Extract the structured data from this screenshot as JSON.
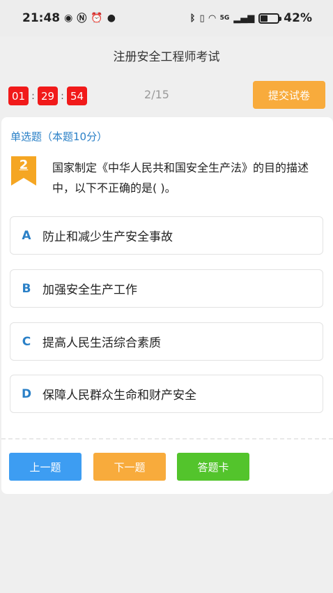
{
  "status": {
    "time": "21:48",
    "battery": "42%",
    "battery_level": 0.42,
    "network": "5G"
  },
  "header": {
    "title": "注册安全工程师考试"
  },
  "timer": {
    "hours": "01",
    "minutes": "29",
    "seconds": "54",
    "separator": ":"
  },
  "progress": "2/15",
  "submit_label": "提交试卷",
  "question": {
    "type_label": "单选题（本题10分）",
    "number": "2",
    "text": "国家制定《中华人民共和国安全生产法》的目的描述中，以下不正确的是( )。",
    "options": [
      {
        "letter": "A",
        "text": "防止和减少生产安全事故"
      },
      {
        "letter": "B",
        "text": "加强安全生产工作"
      },
      {
        "letter": "C",
        "text": "提高人民生活综合素质"
      },
      {
        "letter": "D",
        "text": "保障人民群众生命和财产安全"
      }
    ]
  },
  "nav": {
    "prev_label": "上一题",
    "next_label": "下一题",
    "card_label": "答题卡"
  },
  "colors": {
    "timer_red": "#f11a1a",
    "submit_orange": "#f8ab3c",
    "accent_blue": "#2a80c7",
    "prev_blue": "#3d9df2",
    "next_orange": "#f8ab3c",
    "card_green": "#53c42c",
    "badge_orange": "#f5a623"
  }
}
